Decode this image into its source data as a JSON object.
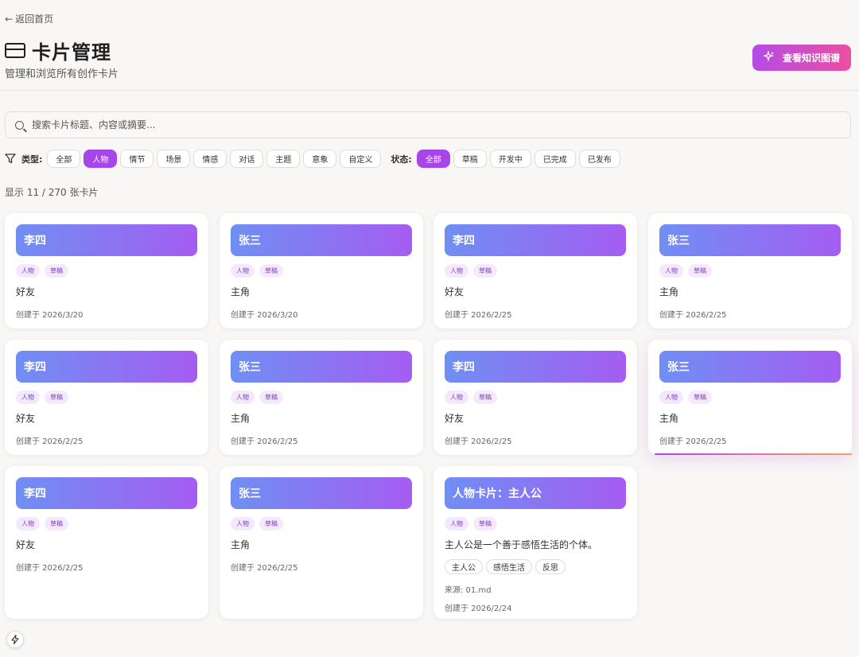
{
  "nav": {
    "back_label": "返回首页",
    "back_arrow": "←"
  },
  "header": {
    "title": "卡片管理",
    "subtitle": "管理和浏览所有创作卡片",
    "graph_button_label": "查看知识图谱",
    "graph_button_icon": "sparkles-icon"
  },
  "search": {
    "placeholder": "搜索卡片标题、内容或摘要...",
    "value": ""
  },
  "filters": {
    "type_label": "类型:",
    "type_options": [
      "全部",
      "人物",
      "情节",
      "场景",
      "情感",
      "对话",
      "主题",
      "意象",
      "自定义"
    ],
    "type_active": "人物",
    "status_label": "状态:",
    "status_options": [
      "全部",
      "草稿",
      "开发中",
      "已完成",
      "已发布"
    ],
    "status_active": "全部"
  },
  "count_text": "显示 11 / 270 张卡片",
  "cards": [
    {
      "title": "李四",
      "type": "人物",
      "status": "草稿",
      "desc": "好友",
      "date": "创建于 2026/3/20"
    },
    {
      "title": "张三",
      "type": "人物",
      "status": "草稿",
      "desc": "主角",
      "date": "创建于 2026/3/20"
    },
    {
      "title": "李四",
      "type": "人物",
      "status": "草稿",
      "desc": "好友",
      "date": "创建于 2026/2/25"
    },
    {
      "title": "张三",
      "type": "人物",
      "status": "草稿",
      "desc": "主角",
      "date": "创建于 2026/2/25"
    },
    {
      "title": "李四",
      "type": "人物",
      "status": "草稿",
      "desc": "好友",
      "date": "创建于 2026/2/25"
    },
    {
      "title": "张三",
      "type": "人物",
      "status": "草稿",
      "desc": "主角",
      "date": "创建于 2026/2/25"
    },
    {
      "title": "李四",
      "type": "人物",
      "status": "草稿",
      "desc": "好友",
      "date": "创建于 2026/2/25"
    },
    {
      "title": "张三",
      "type": "人物",
      "status": "草稿",
      "desc": "主角",
      "date": "创建于 2026/2/25"
    },
    {
      "title": "李四",
      "type": "人物",
      "status": "草稿",
      "desc": "好友",
      "date": "创建于 2026/2/25"
    },
    {
      "title": "张三",
      "type": "人物",
      "status": "草稿",
      "desc": "主角",
      "date": "创建于 2026/2/25"
    },
    {
      "title": "人物卡片：主人公",
      "type": "人物",
      "status": "草稿",
      "desc": "主人公是一个善于感悟生活的个体。",
      "keywords": [
        "主人公",
        "感悟生活",
        "反思"
      ],
      "source": "来源: 01.md",
      "date": "创建于 2026/2/24"
    }
  ],
  "colors": {
    "accent": "#a845e8",
    "gradient_start": "#6f8ff3",
    "gradient_end": "#a55cf2",
    "button_start": "#b44ce6",
    "button_end": "#ec4fa0"
  },
  "fab_icon": "lightning-icon"
}
